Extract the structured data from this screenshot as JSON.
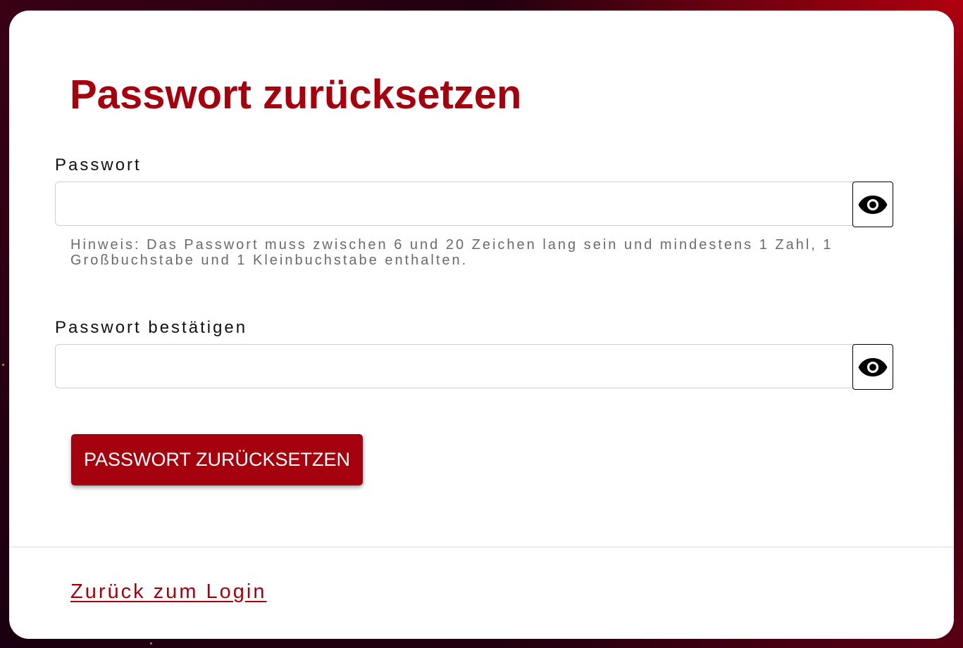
{
  "page": {
    "title": "Passwort zurücksetzen"
  },
  "form": {
    "password": {
      "label": "Passwort",
      "value": "",
      "placeholder": "",
      "toggle_icon": "eye-icon"
    },
    "hint": "Hinweis: Das Passwort muss zwischen 6 und 20 Zeichen lang sein und mindestens 1 Zahl, 1 Großbuchstabe und 1 Kleinbuchstabe enthalten.",
    "confirm_password": {
      "label": "Passwort bestätigen",
      "value": "",
      "placeholder": "",
      "toggle_icon": "eye-icon"
    },
    "submit_label": "PASSWORT ZURÜCKSETZEN"
  },
  "footer": {
    "back_link": "Zurück zum Login"
  },
  "colors": {
    "brand": "#a4000e",
    "hint_text": "#6b6b6b",
    "card_background": "#ffffff"
  }
}
